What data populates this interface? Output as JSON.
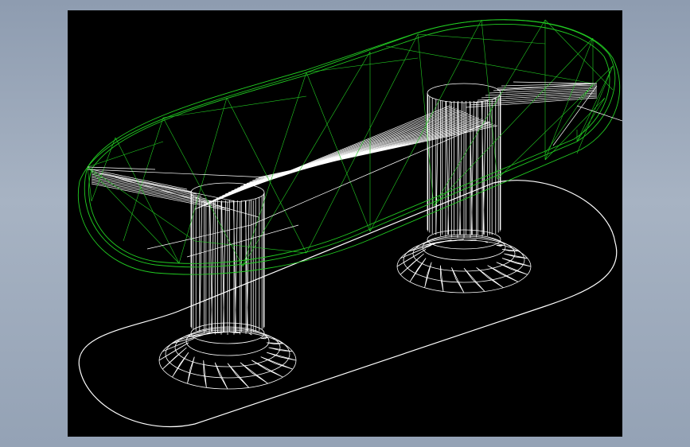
{
  "scene": {
    "background_color": "#000000",
    "frame_color": "#9aa7b8",
    "top_wire_color": "#22cc22",
    "body_wire_color": "#ffffff",
    "base_outline_color": "#ffffff",
    "model": "oval-table-wireframe"
  }
}
